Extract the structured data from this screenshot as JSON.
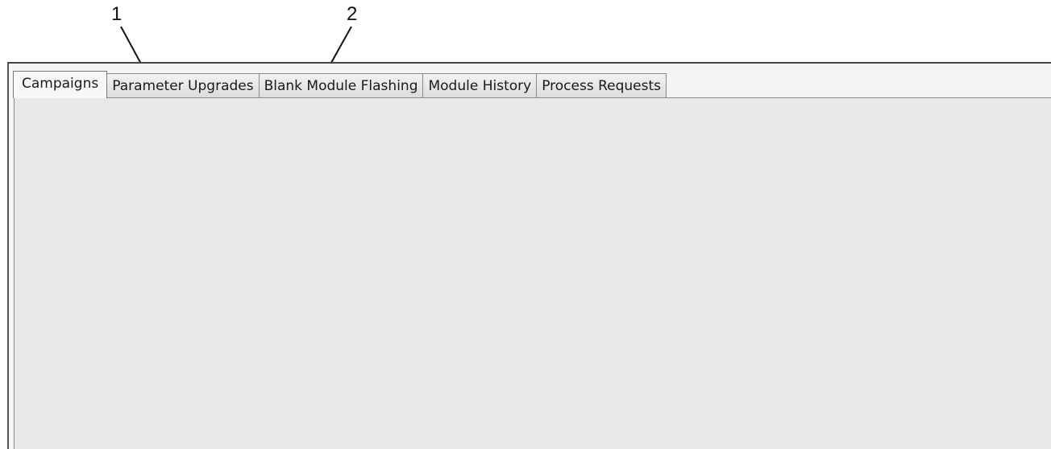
{
  "callouts": [
    "1",
    "2"
  ],
  "tabs": [
    {
      "label": "Campaigns",
      "active": true
    },
    {
      "label": "Parameter Upgrades",
      "active": false
    },
    {
      "label": "Blank Module Flashing",
      "active": false
    },
    {
      "label": "Module History",
      "active": false
    },
    {
      "label": "Process Requests",
      "active": false
    }
  ]
}
